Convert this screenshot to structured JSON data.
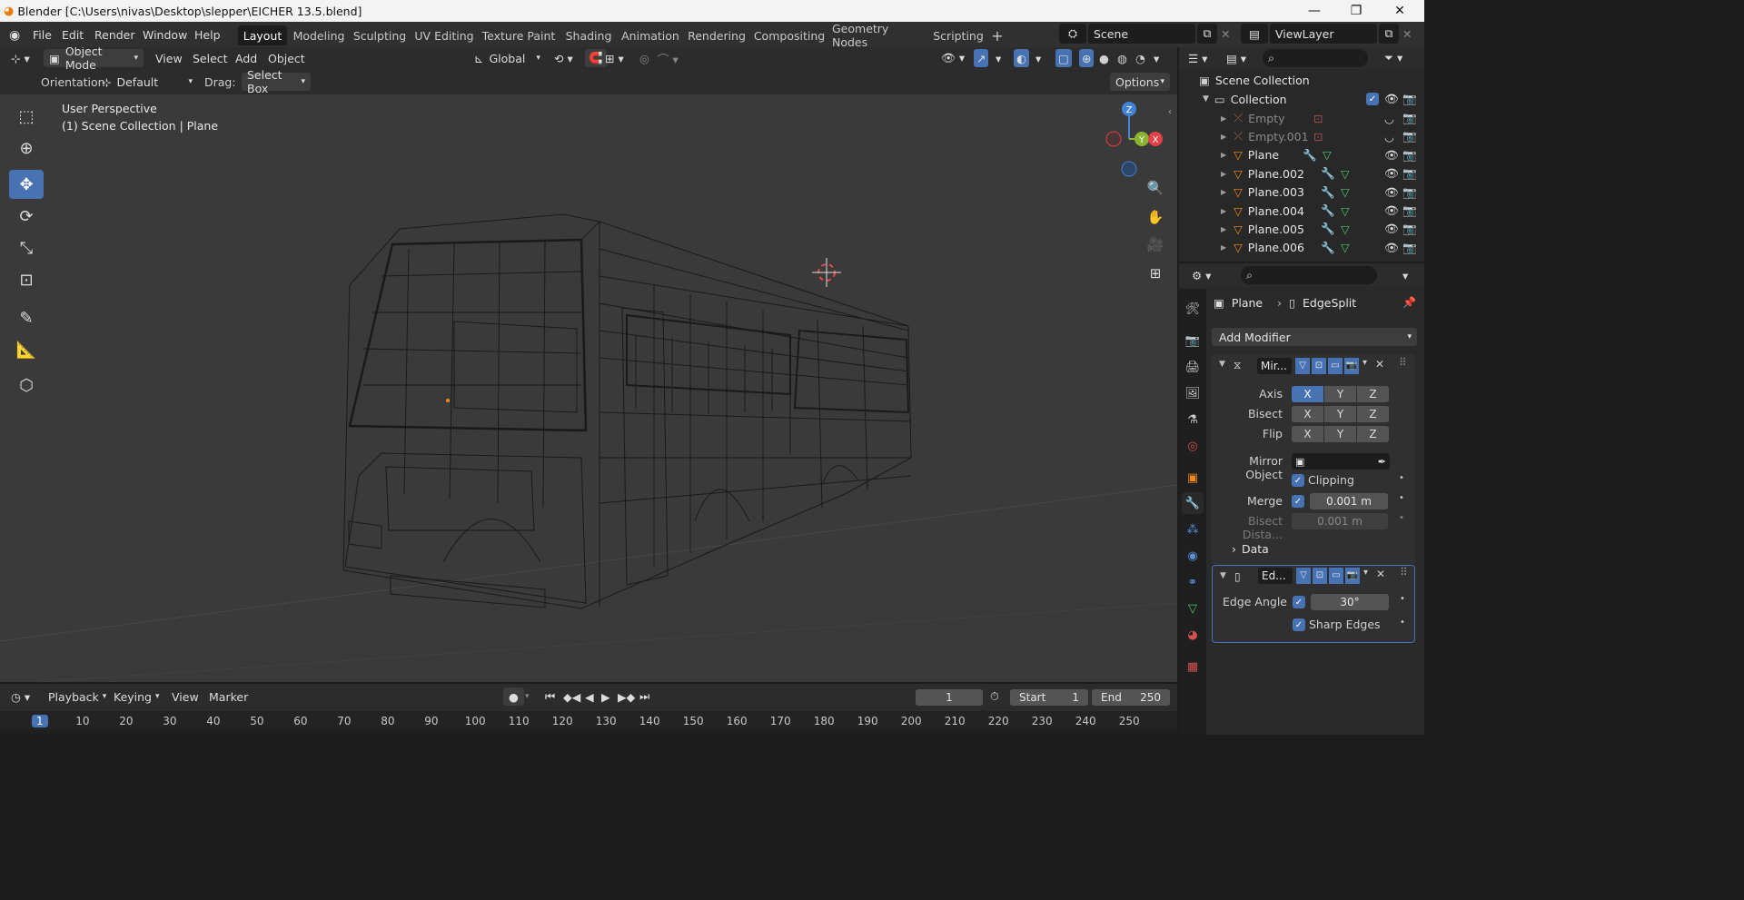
{
  "window": {
    "title": "Blender [C:\\Users\\nivas\\Desktop\\slepper\\EICHER 13.5.blend]",
    "minimize": "—",
    "maximize": "❐",
    "close": "✕"
  },
  "menu": [
    "File",
    "Edit",
    "Render",
    "Window",
    "Help"
  ],
  "workspaces": [
    "Layout",
    "Modeling",
    "Sculpting",
    "UV Editing",
    "Texture Paint",
    "Shading",
    "Animation",
    "Rendering",
    "Compositing",
    "Geometry Nodes",
    "Scripting"
  ],
  "scene": {
    "name": "Scene",
    "view_layer": "ViewLayer"
  },
  "viewport": {
    "mode": "Object Mode",
    "menus": [
      "View",
      "Select",
      "Add",
      "Object"
    ],
    "transform_space": "Global",
    "orientation_label": "Orientation:",
    "orientation_value": "Default",
    "drag_label": "Drag:",
    "drag_value": "Select Box",
    "options": "Options",
    "perspective_label": "User Perspective",
    "collection_label": "(1) Scene Collection | Plane"
  },
  "gizmo": {
    "z": "Z",
    "y": "Y",
    "x": "X"
  },
  "outliner": {
    "root": "Scene Collection",
    "collection": "Collection",
    "items": [
      {
        "name": "Empty",
        "type": "empty",
        "dim": true
      },
      {
        "name": "Empty.001",
        "type": "empty",
        "dim": true
      },
      {
        "name": "Plane",
        "type": "mesh",
        "dim": false
      },
      {
        "name": "Plane.002",
        "type": "mesh",
        "dim": false
      },
      {
        "name": "Plane.003",
        "type": "mesh",
        "dim": false
      },
      {
        "name": "Plane.004",
        "type": "mesh",
        "dim": false
      },
      {
        "name": "Plane.005",
        "type": "mesh",
        "dim": false
      },
      {
        "name": "Plane.006",
        "type": "mesh",
        "dim": false
      }
    ]
  },
  "properties": {
    "breadcrumb_object": "Plane",
    "breadcrumb_modifier": "EdgeSplit",
    "add_modifier": "Add Modifier",
    "mirror": {
      "name": "Mir...",
      "axis_label": "Axis",
      "bisect_label": "Bisect",
      "flip_label": "Flip",
      "x": "X",
      "y": "Y",
      "z": "Z",
      "mirror_object_label": "Mirror Object",
      "clipping_label": "Clipping",
      "merge_label": "Merge",
      "merge_value": "0.001 m",
      "bisect_distance_label": "Bisect Dista...",
      "bisect_distance_value": "0.001 m",
      "data_label": "Data"
    },
    "edgesplit": {
      "name": "Ed...",
      "edge_angle_label": "Edge Angle",
      "edge_angle_value": "30°",
      "sharp_edges_label": "Sharp Edges"
    }
  },
  "timeline": {
    "menus": [
      "Playback",
      "Keying",
      "View",
      "Marker"
    ],
    "current_frame": "1",
    "start_label": "Start",
    "start_value": "1",
    "end_label": "End",
    "end_value": "250",
    "ticks": [
      "1",
      "10",
      "20",
      "30",
      "40",
      "50",
      "60",
      "70",
      "80",
      "90",
      "100",
      "110",
      "120",
      "130",
      "140",
      "150",
      "160",
      "170",
      "180",
      "190",
      "200",
      "210",
      "220",
      "230",
      "240",
      "250"
    ]
  },
  "colors": {
    "accent": "#4772b3",
    "axis_x": "#e0424a",
    "axis_y": "#8bb430",
    "axis_z": "#3f82d7",
    "wire": "#111111"
  }
}
